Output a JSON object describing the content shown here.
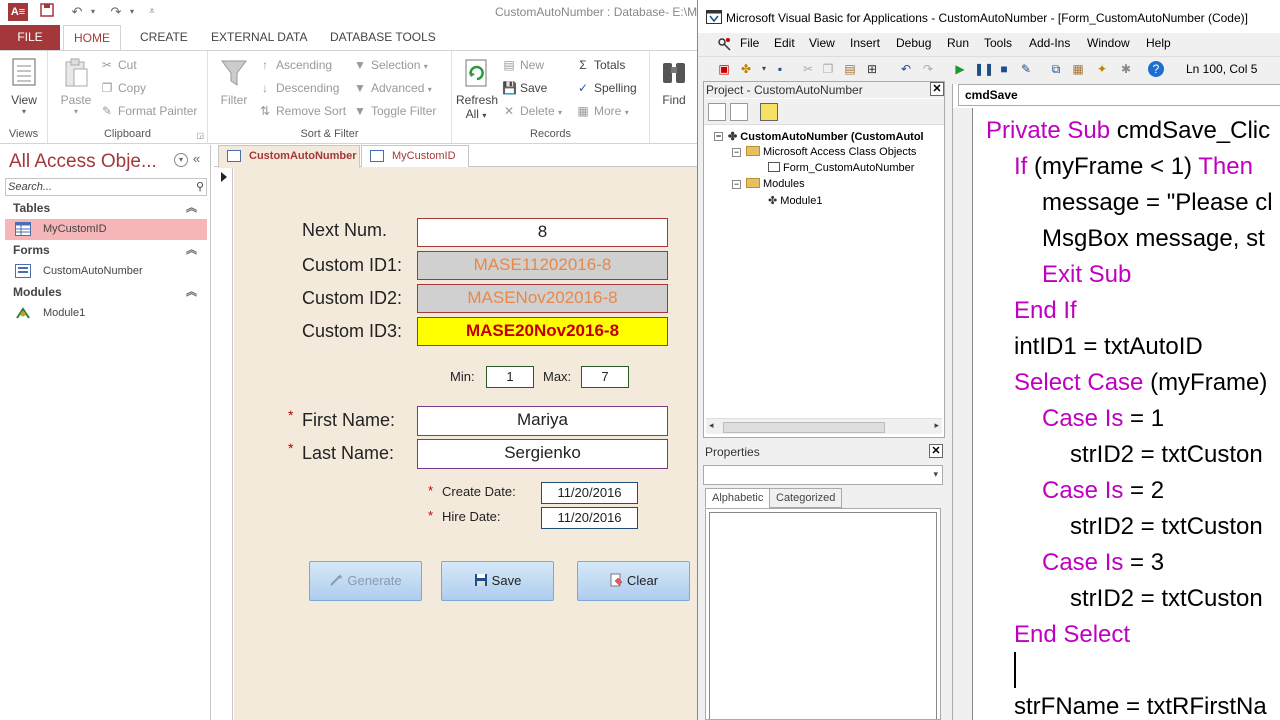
{
  "access": {
    "logo": "A≡",
    "title": "CustomAutoNumber : Database- E:\\M",
    "tabs": [
      "FILE",
      "HOME",
      "CREATE",
      "EXTERNAL DATA",
      "DATABASE TOOLS"
    ],
    "ribbon": {
      "views": {
        "view_label": "View",
        "group": "Views"
      },
      "clipboard": {
        "paste": "Paste",
        "cut": "Cut",
        "copy": "Copy",
        "format_painter": "Format Painter",
        "group": "Clipboard"
      },
      "sort_filter": {
        "filter": "Filter",
        "ascending": "Ascending",
        "descending": "Descending",
        "remove_sort": "Remove Sort",
        "selection": "Selection",
        "advanced": "Advanced",
        "toggle_filter": "Toggle Filter",
        "group": "Sort & Filter"
      },
      "records": {
        "refresh": "Refresh",
        "refresh2": "All",
        "new": "New",
        "save": "Save",
        "delete": "Delete",
        "totals": "Totals",
        "spelling": "Spelling",
        "more": "More",
        "group": "Records"
      },
      "find": {
        "find": "Find"
      }
    },
    "nav": {
      "title": "All Access Obje...",
      "search_placeholder": "Search...",
      "sections": [
        {
          "label": "Tables",
          "items": [
            "MyCustomID"
          ]
        },
        {
          "label": "Forms",
          "items": [
            "CustomAutoNumber"
          ]
        },
        {
          "label": "Modules",
          "items": [
            "Module1"
          ]
        }
      ]
    },
    "doc_tabs": [
      "CustomAutoNumber",
      "MyCustomID"
    ],
    "form": {
      "next_num": {
        "label": "Next Num.",
        "value": "8"
      },
      "custom_id1": {
        "label": "Custom ID1:",
        "value": "MASE11202016-8"
      },
      "custom_id2": {
        "label": "Custom ID2:",
        "value": "MASENov202016-8"
      },
      "custom_id3": {
        "label": "Custom ID3:",
        "value": "MASE20Nov2016-8"
      },
      "min": {
        "label": "Min:",
        "value": "1"
      },
      "max": {
        "label": "Max:",
        "value": "7"
      },
      "first_name": {
        "label": "First Name:",
        "value": "Mariya"
      },
      "last_name": {
        "label": "Last Name:",
        "value": "Sergienko"
      },
      "create_date": {
        "label": "Create Date:",
        "value": "11/20/2016"
      },
      "hire_date": {
        "label": "Hire Date:",
        "value": "11/20/2016"
      },
      "required_mark": "*",
      "buttons": {
        "generate": "Generate",
        "save": "Save",
        "clear": "Clear"
      }
    }
  },
  "vba": {
    "title": "Microsoft Visual Basic for Applications - CustomAutoNumber - [Form_CustomAutoNumber (Code)]",
    "menu": [
      "File",
      "Edit",
      "View",
      "Insert",
      "Debug",
      "Run",
      "Tools",
      "Add-Ins",
      "Window",
      "Help"
    ],
    "position": "Ln 100, Col 5",
    "project_title": "Project - CustomAutoNumber",
    "tree": {
      "root": "CustomAutoNumber (CustomAutol",
      "class_objects": "Microsoft Access Class Objects",
      "form": "Form_CustomAutoNumber",
      "modules": "Modules",
      "module1": "Module1"
    },
    "properties_title": "Properties",
    "prop_tabs": [
      "Alphabetic",
      "Categorized"
    ],
    "object_dropdown": "cmdSave",
    "code_lines": [
      {
        "kw": "Private Sub",
        "rest": " cmdSave_Clic"
      },
      {
        "kw": "If",
        "rest": " (myFrame < 1) ",
        "kw2": "Then"
      },
      {
        "kw": "",
        "rest": "message = \"Please cl"
      },
      {
        "kw": "",
        "rest": "MsgBox message, st"
      },
      {
        "kw": "Exit Sub",
        "rest": ""
      },
      {
        "kw": "End If",
        "rest": ""
      },
      {
        "kw": "",
        "rest": "intID1 = txtAutoID"
      },
      {
        "kw": "Select Case",
        "rest": " (myFrame)"
      },
      {
        "kw": "Case Is",
        "rest": " = 1"
      },
      {
        "kw": "",
        "rest": "strID2 = txtCuston"
      },
      {
        "kw": "Case Is",
        "rest": " = 2"
      },
      {
        "kw": "",
        "rest": "strID2 = txtCuston"
      },
      {
        "kw": "Case Is",
        "rest": " = 3"
      },
      {
        "kw": "",
        "rest": "strID2 = txtCuston"
      },
      {
        "kw": "End Select",
        "rest": ""
      },
      {
        "kw": "",
        "rest": ""
      },
      {
        "kw": "",
        "rest": "strFName = txtRFirstNa"
      }
    ]
  }
}
